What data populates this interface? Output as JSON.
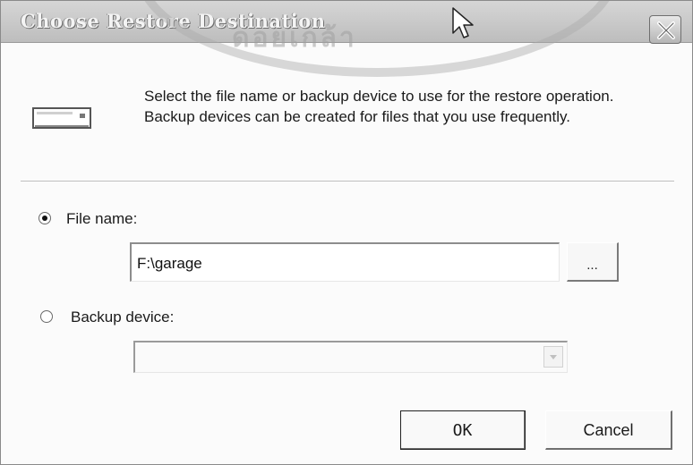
{
  "dialog": {
    "title": "Choose Restore Destination",
    "description": "Select the file name or backup device to use for the restore operation.  Backup devices can be created for files that you use frequently.",
    "file_name": {
      "label": "File name:",
      "value": "F:\\garage",
      "selected": true,
      "browse_label": "..."
    },
    "backup_device": {
      "label": "Backup device:",
      "selected": false,
      "value": ""
    },
    "buttons": {
      "ok": "OK",
      "cancel": "Cancel"
    }
  },
  "watermark": {
    "text": "ดอยเกล้า"
  },
  "icons": {
    "close": "close-icon",
    "drive": "tape-drive-icon",
    "cursor": "mouse-pointer-icon",
    "dropdown": "chevron-down-icon"
  },
  "colors": {
    "titlebar": "#c9c9c9",
    "dialog_bg": "#fbfbfb",
    "title_text": "#f4f4f4"
  }
}
